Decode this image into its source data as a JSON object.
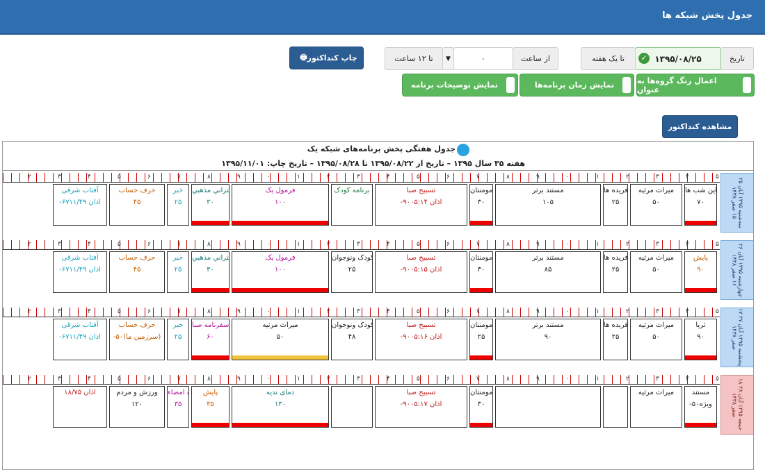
{
  "header": {
    "title": "جدول پخش شبکه ها"
  },
  "toolbar": {
    "date_label": "تاریخ",
    "date_value": "۱۳۹۵/۰۸/۲۵",
    "range_label": "تا یک هفته",
    "from_label": "از ساعت",
    "from_value": "۰",
    "to_value": "تا ۱۲ ساعت",
    "print_label": "چاپ کنداکتور",
    "opt1": "اعمال رنگ گروه‌ها به عنوان",
    "opt2": "نمایش زمان برنامه‌ها",
    "opt3": "نمایش توضیحات برنامه",
    "view_label": "مشاهده کنداکتور"
  },
  "sheet": {
    "title": "جدول هفتگی پخش برنامه‌های شبکه یک",
    "subtitle": "هفته ۳۵ سال ۱۳۹۵ – تاریخ از ۱۳۹۵/۰۸/۲۲ تا ۱۳۹۵/۰۸/۲۸ – تاریخ چاپ: ۱۳۹۵/۱۱/۰۱"
  },
  "ruler": [
    "۵",
    "۴",
    "۳",
    "۲",
    "۱",
    "۰",
    "۹",
    "۸",
    "۷",
    "۶",
    "۵",
    "۴",
    "۳",
    "۲",
    "۱",
    "۰",
    "۹",
    "۸",
    "۷",
    "۶",
    "۵",
    "۴",
    "۳",
    "۲"
  ],
  "days": [
    {
      "label": "سه‌شنبه ۱۳۹۵ آبان ۲۵ ۱۵ صفر ۱۴۳۸",
      "fri": false,
      "progs": [
        {
          "n": "این شب ها",
          "d": "۷۰",
          "c": "bk"
        },
        {
          "n": "میراث مرثیه",
          "d": "۵۰",
          "c": "bk"
        },
        {
          "n": "دست آفریده ها",
          "d": "۲۵",
          "c": "bk"
        },
        {
          "n": "مستند برتر",
          "d": "۱۰۵",
          "c": "bk"
        },
        {
          "n": "مومنتان",
          "d": "۳۰",
          "c": "bk"
        },
        {
          "n": "تسبیح صبا",
          "d": "-۹۰اذان ۰۵:۱۴",
          "c": "rd"
        },
        {
          "n": "برنامه کودک",
          "d": "",
          "c": "gr"
        },
        {
          "n": "فرمول یک",
          "d": "۱۰۰",
          "c": "pu"
        },
        {
          "n": "سختراني مذهبي",
          "d": "۳۰",
          "c": "tl"
        },
        {
          "n": "خبر",
          "d": "۲۵",
          "c": "cy"
        },
        {
          "n": "حرف حساب",
          "d": "۴۵",
          "c": "or"
        },
        {
          "n": "آفتاب شرقی",
          "d": "-۶۷اذان ۱۱/۴۹",
          "c": "cy"
        }
      ]
    },
    {
      "label": "چهارشنبه ۱۳۹۵ آبان ۲۶ ۱۶ صفر ۱۴۳۸",
      "fri": false,
      "progs": [
        {
          "n": "پایش",
          "d": "۹۰",
          "c": "or"
        },
        {
          "n": "میراث مرثیه",
          "d": "۵۰",
          "c": "bk"
        },
        {
          "n": "دست آفریده ها",
          "d": "۲۵",
          "c": "bk"
        },
        {
          "n": "مستند برتر",
          "d": "۸۵",
          "c": "bk"
        },
        {
          "n": "با مومنتان",
          "d": "۳۰",
          "c": "bk"
        },
        {
          "n": "تسبیح صبا",
          "d": "-۹۰اذان ۰۵:۱۵",
          "c": "rd"
        },
        {
          "n": "کودک ونوجوان",
          "d": "۲۵",
          "c": "bk"
        },
        {
          "n": "فرمول یک",
          "d": "۱۰۰",
          "c": "pu"
        },
        {
          "n": "سختراني مذهبي",
          "d": "۳۰",
          "c": "tl"
        },
        {
          "n": "خبر",
          "d": "۲۵",
          "c": "cy"
        },
        {
          "n": "حرف حساب",
          "d": "۴۵",
          "c": "or"
        },
        {
          "n": "آفتاب شرقی",
          "d": "-۶۷اذان ۱۱/۴۹",
          "c": "cy"
        }
      ]
    },
    {
      "label": "پنجشنبه ۱۳۹۵ آبان ۲۷ ۱۷ صفر ۱۴۳۸",
      "fri": false,
      "progs": [
        {
          "n": "ثریا",
          "d": "۹۰",
          "c": "bk"
        },
        {
          "n": "میراث مرثیه",
          "d": "۵۰",
          "c": "bk"
        },
        {
          "n": "دست آفریده ها",
          "d": "۲۵",
          "c": "bk"
        },
        {
          "n": "مستند برتر",
          "d": "۹۰",
          "c": "bk"
        },
        {
          "n": "با مومنتان",
          "d": "۲۵",
          "c": "bk"
        },
        {
          "n": "تسبیح صبا",
          "d": "-۹۰اذان ۰۵:۱۶",
          "c": "rd"
        },
        {
          "n": "برنامه کودک ونوجوان",
          "d": "۴۸",
          "c": "bk"
        },
        {
          "n": "میراث مرثیه",
          "d": "۵۰",
          "c": "bk"
        },
        {
          "n": "سفرنامه صبا",
          "d": "۶۰",
          "c": "pu"
        },
        {
          "n": "خبر",
          "d": "۲۵",
          "c": "cy"
        },
        {
          "n": "حرف حساب",
          "d": "-۵۰(سرزمین ما)",
          "c": "or"
        },
        {
          "n": "آفتاب شرقی",
          "d": "-۶۷اذان ۱۱/۴۹",
          "c": "cy"
        }
      ]
    },
    {
      "label": "جمعه ۱۳۹۵ آبان ۲۸ ۱۸ صفر ۱۴۳۸",
      "fri": true,
      "progs": [
        {
          "n": "مستند",
          "d": "-۵۰ویژه",
          "c": "bk"
        },
        {
          "n": "میراث مرثیه",
          "d": "",
          "c": "bk"
        },
        {
          "n": "",
          "d": "",
          "c": "bk"
        },
        {
          "n": "",
          "d": "",
          "c": "bk"
        },
        {
          "n": "با مومنتان",
          "d": "۳۰",
          "c": "bk"
        },
        {
          "n": "تسبیح صبا",
          "d": "-۹۰اذان ۰۵:۱۷",
          "c": "rd"
        },
        {
          "n": "",
          "d": "",
          "c": "bk"
        },
        {
          "n": "دمای نديه",
          "d": "۱۳۰",
          "c": "tl"
        },
        {
          "n": "پایش",
          "d": "۳۵",
          "c": "or"
        },
        {
          "n": "یک خاطره یک امضاء",
          "d": "۳۵",
          "c": "pu"
        },
        {
          "n": "ورزش و مردم",
          "d": "۱۲۰",
          "c": "bk"
        },
        {
          "n": "اذان ۱۸/۷۵",
          "d": "",
          "c": "rd"
        }
      ]
    }
  ]
}
